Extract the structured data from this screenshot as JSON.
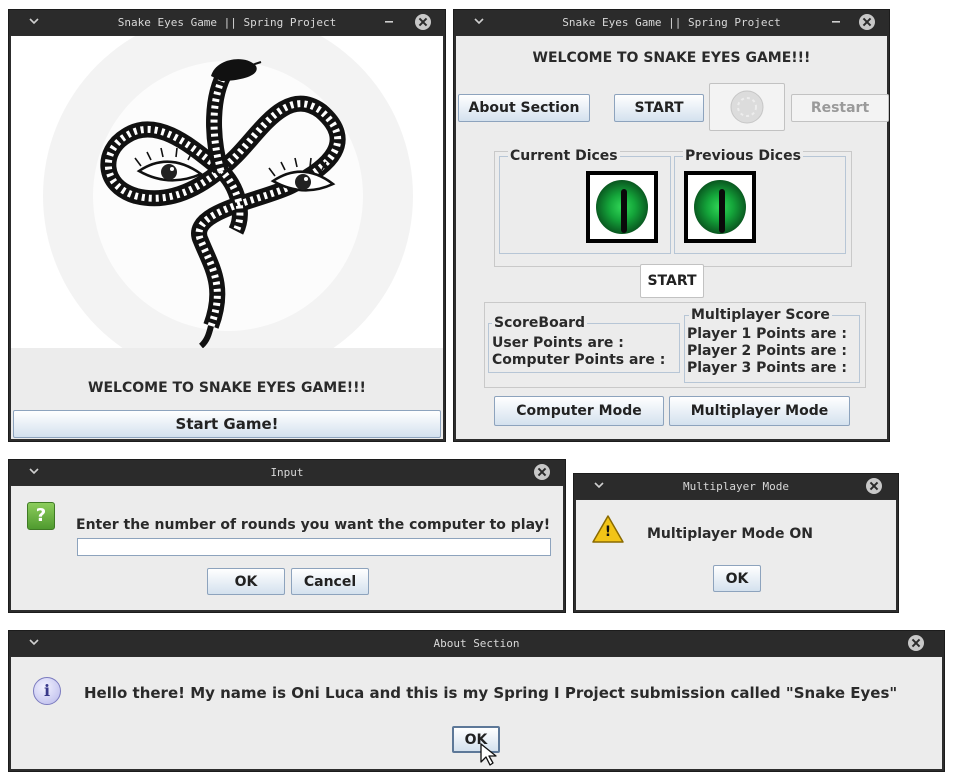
{
  "window1": {
    "title": "Snake Eyes Game || Spring Project",
    "welcome": "WELCOME TO SNAKE EYES GAME!!!",
    "start_button": "Start Game!"
  },
  "window2": {
    "title": "Snake Eyes Game || Spring Project",
    "welcome": "WELCOME TO SNAKE EYES GAME!!!",
    "about_button": "About Section",
    "start_button": "START",
    "restart_button": "Restart",
    "current_dices": "Current Dices",
    "previous_dices": "Previous Dices",
    "start_button_2": "START",
    "scoreboard": {
      "title": "ScoreBoard",
      "user_points": "User Points are :",
      "computer_points": "Computer Points are :"
    },
    "multiplayer_score": {
      "title": "Multiplayer Score",
      "player1": "Player 1 Points are :",
      "player2": "Player 2 Points are :",
      "player3": "Player 3 Points are :"
    },
    "computer_mode_button": "Computer Mode",
    "multiplayer_mode_button": "Multiplayer Mode"
  },
  "input_dialog": {
    "title": "Input",
    "icon_glyph": "?",
    "message": "Enter the number of rounds you want the computer to play!",
    "input_value": "",
    "ok_button": "OK",
    "cancel_button": "Cancel"
  },
  "multiplayer_dialog": {
    "title": "Multiplayer Mode",
    "icon_glyph": "!",
    "message": "Multiplayer Mode ON",
    "ok_button": "OK"
  },
  "about_dialog": {
    "title": "About Section",
    "icon_glyph": "i",
    "message": "Hello there! My name is Oni Luca and this is my Spring I Project submission called \"Snake Eyes\"",
    "ok_button": "OK"
  },
  "colors": {
    "titlebar": "#2b2b2b",
    "panel": "#ececec",
    "button_border": "#8da3bd",
    "die_eye": "#14a53a",
    "question_icon": "#5aa23c",
    "warning_icon": "#f2c417",
    "info_icon": "#c9c9f0"
  }
}
